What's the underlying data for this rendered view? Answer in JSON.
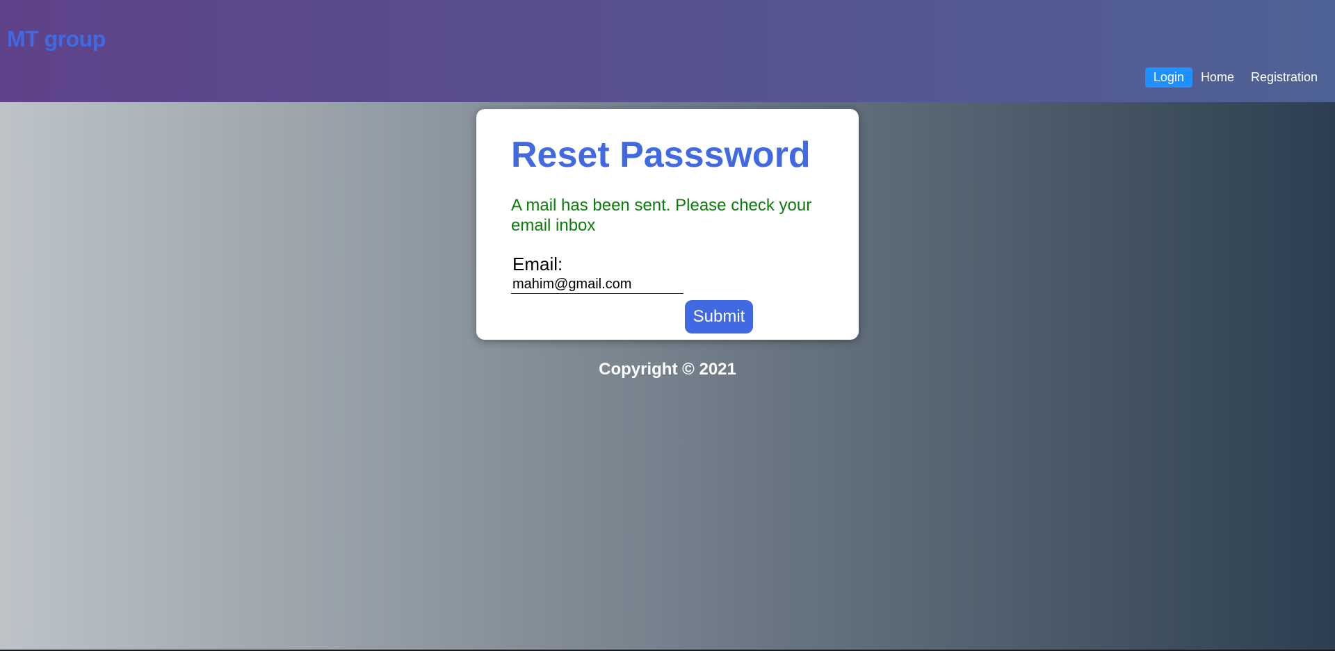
{
  "header": {
    "brand": "MT group",
    "nav": [
      {
        "label": "Login",
        "active": true
      },
      {
        "label": "Home",
        "active": false
      },
      {
        "label": "Registration",
        "active": false
      }
    ]
  },
  "card": {
    "title": "Reset Passsword",
    "message": "A mail has been sent. Please check your email inbox",
    "email_label": "Email:",
    "email_value": "mahim@gmail.com",
    "submit_label": "Submit"
  },
  "footer": {
    "copyright": "Copyright © 2021"
  },
  "colors": {
    "accent": "#4169e1",
    "nav_active": "#1e90ff",
    "success": "#0a7d0a"
  }
}
